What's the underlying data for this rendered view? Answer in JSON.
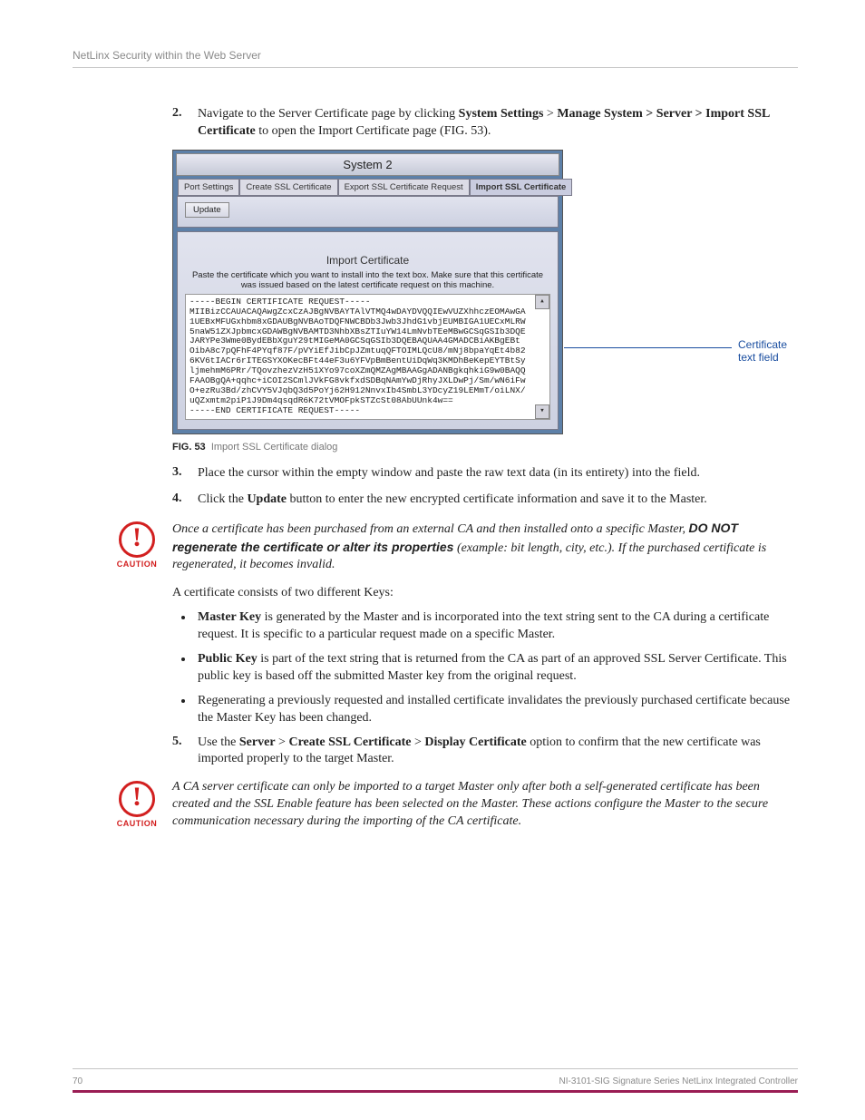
{
  "header": "NetLinx Security within the Web Server",
  "steps": {
    "s2": {
      "num": "2.",
      "p1": "Navigate to the Server Certificate page by clicking ",
      "b1": "System Settings",
      "g1": " > ",
      "b2": "Manage System > Server > Import SSL Certificate",
      "p2": " to open the Import Certificate page (FIG. 53)."
    },
    "s3": {
      "num": "3.",
      "text": "Place the cursor within the empty window and paste the raw text data (in its entirety) into the field."
    },
    "s4": {
      "num": "4.",
      "p1": "Click the ",
      "b1": "Update",
      "p2": " button to enter the new encrypted certificate information and save it to the Master."
    },
    "s5": {
      "num": "5.",
      "p1": "Use the ",
      "b1": "Server",
      "g1": " > ",
      "b2": "Create SSL Certificate",
      "g2": " > ",
      "b3": "Display Certificate",
      "p2": " option to confirm that the new certificate was imported properly to the target Master."
    }
  },
  "figure": {
    "window_title": "System 2",
    "tabs": [
      "Port Settings",
      "Create SSL Certificate",
      "Export SSL Certificate Request",
      "Import SSL Certificate"
    ],
    "active_tab": 3,
    "update_btn": "Update",
    "section_title": "Import Certificate",
    "hint": "Paste the certificate which you want to install into the text box. Make sure that this certificate was issued based on the latest certificate request on this machine.",
    "cert_text": "-----BEGIN CERTIFICATE REQUEST-----\nMIIBizCCAUACAQAwgZcxCzAJBgNVBAYTAlVTMQ4wDAYDVQQIEwVUZXhhczEOMAwGA\n1UEBxMFUGxhbm8xGDAUBgNVBAoTDQFNWCBDb3Jwb3JhdG1vbjEUMBIGA1UECxMLRW\n5naW51ZXJpbmcxGDAWBgNVBAMTD3NhbXBsZTIuYW14LmNvbTEeMBwGCSqGSIb3DQE\nJARYPe3Wme0BydEBbXguY29tMIGeMA0GCSqGSIb3DQEBAQUAA4GMADCBiAKBgEBt\nOibA8c7pQFhF4PYqf87F/pVYiEfJibCpJZmtuqQFTOIMLQcU8/mNj8bpaYqEt4b82\n6KV6tIACr6rITEGSYXOKecBFt44eF3u6YFVpBmBentUiDqWq3KMDhBeKepEYTBtSy\nljmehmM6PRr/TQovzhezVzH51XYo97coXZmQMZAgMBAAGgADANBgkqhkiG9w0BAQQ\nFAAOBgQA+qqhc+iCOI2SCmlJVkFG8vkfxdSDBqNAmYwDjRhyJXLDwPj/Sm/wN6iFw\nO+ezRu3Bd/zhCVY5VJqbQ3d5PoYj62H912NnvxIb4SmbL3YDcyZ19LEMmT/oiLNX/\nuQZxmtm2piP1J9Dm4qsqdR6K72tVMOFpkSTZcSt08AbUUnk4w==\n-----END CERTIFICATE REQUEST-----",
    "callout": "Certificate text field",
    "caption_label": "FIG. 53",
    "caption_text": "Import SSL Certificate dialog"
  },
  "caution1": {
    "p1": "Once a certificate has been purchased from an external CA and then installed onto a specific Master, ",
    "b1": "DO NOT regenerate the certificate or alter its properties",
    "p2": " (example: bit length, city, etc.). If the purchased certificate is regenerated, it becomes invalid."
  },
  "caution_label": "CAUTION",
  "para_keys": "A certificate consists of two different Keys:",
  "keys": {
    "k1": {
      "b": "Master Key",
      "t": " is generated by the Master and is incorporated into the text string sent to the CA during a certificate request. It is specific to a particular request made on a specific Master."
    },
    "k2": {
      "b": "Public Key",
      "t": " is part of the text string that is returned from the CA as part of an approved SSL Server Certificate. This public key is based off the submitted Master key from the original request."
    },
    "k3": {
      "t": "Regenerating a previously requested and installed certificate invalidates the previously purchased certificate because the Master Key has been changed."
    }
  },
  "caution2": "A CA server certificate can only be imported to a target Master only after both a self-generated certificate has been created and the SSL Enable feature has been selected on the Master. These actions configure the Master to the secure communication necessary during the importing of the CA certificate.",
  "footer": {
    "page": "70",
    "title": "NI-3101-SIG Signature Series NetLinx Integrated Controller"
  }
}
